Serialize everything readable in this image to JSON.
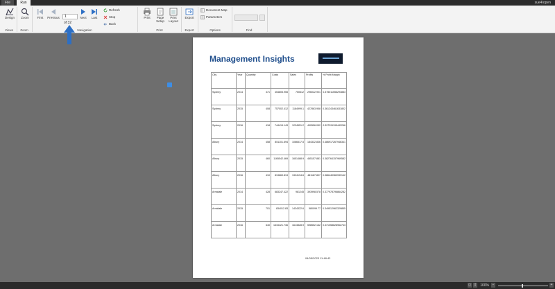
{
  "tabs": {
    "file": "File",
    "run": "Run"
  },
  "user": "sue4\\open",
  "ribbon": {
    "design": "Design",
    "zoom": "Zoom",
    "first": "First",
    "previous": "Previous",
    "next": "Next",
    "last": "Last",
    "refresh": "Refresh",
    "stop": "Stop",
    "back": "Back",
    "print": "Print",
    "page_setup": "Page Setup",
    "print_layout": "Print Layout",
    "export": "Export",
    "document_map": "Document Map",
    "parameters": "Parameters",
    "page_value": "1",
    "page_of": "of 32",
    "groups": {
      "views": "Views",
      "zoom": "Zoom",
      "navigation": "Navigation",
      "print": "Print",
      "export": "Export",
      "options": "Options",
      "find": "Find"
    }
  },
  "report": {
    "title": "Management Insights",
    "headers": [
      "City",
      "Year",
      "Quantity",
      "Costs",
      "Sales",
      "Profits",
      "% Profit Margin"
    ],
    "rows": [
      [
        "Sydney",
        "2014",
        "371",
        "454805.955",
        "750612",
        "296022.901",
        "0.375011556293883"
      ],
      [
        "Sydney",
        "2015",
        "408",
        "757002.412",
        "1184999.1",
        "427863.958",
        "0.361243461631802"
      ],
      [
        "Sydney",
        "2016",
        "418",
        "744415.143",
        "1234551.2",
        "490556.052",
        "0.397291195442266"
      ],
      [
        "Albury",
        "2014",
        "458",
        "851101.694",
        "1066517.5",
        "184332.836",
        "0.486917267946341"
      ],
      [
        "Albury",
        "2015",
        "460",
        "1165542.469",
        "1651488.9",
        "465157.881",
        "0.382764157969582"
      ],
      [
        "Albury",
        "2016",
        "410",
        "813669.813",
        "1324194.6",
        "481187.807",
        "0.386440360933142"
      ],
      [
        "Armidale",
        "2014",
        "428",
        "683247.422",
        "981245",
        "393998.578",
        "0.377978796864282"
      ],
      [
        "Armidale",
        "2015",
        "701",
        "834012.83",
        "1434322.6",
        "580099.77",
        "0.349512962329855"
      ],
      [
        "Armidale",
        "2016",
        "640",
        "1615421.736",
        "1613828.9",
        "598552.162",
        "0.371058628962743"
      ]
    ],
    "timestamp": "04/05/2023 11:48:42"
  },
  "status": {
    "zoom": "100%"
  }
}
